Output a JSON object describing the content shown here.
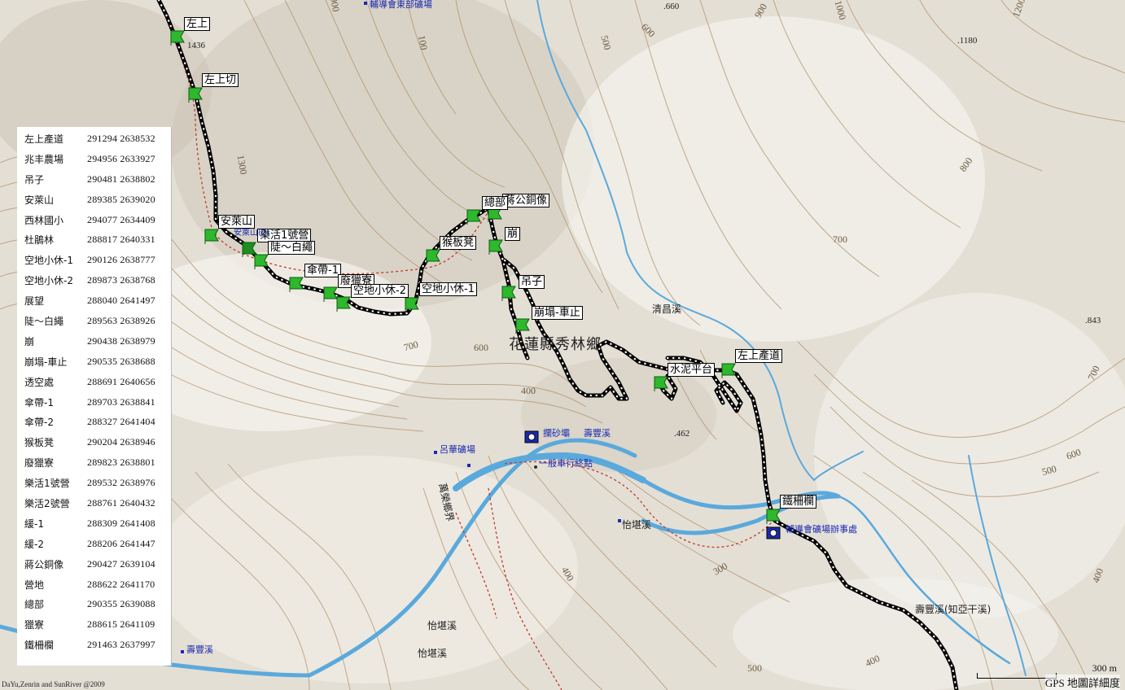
{
  "waypoint_table": [
    {
      "name": "左上產道",
      "e": "291294",
      "n": "2638532"
    },
    {
      "name": "兆丰農場",
      "e": "294956",
      "n": "2633927"
    },
    {
      "name": "吊子",
      "e": "290481",
      "n": "2638802"
    },
    {
      "name": "安萊山",
      "e": "289385",
      "n": "2639020"
    },
    {
      "name": "西林國小",
      "e": "294077",
      "n": "2634409"
    },
    {
      "name": "杜鵑林",
      "e": "288817",
      "n": "2640331"
    },
    {
      "name": "空地小休-1",
      "e": "290126",
      "n": "2638777"
    },
    {
      "name": "空地小休-2",
      "e": "289873",
      "n": "2638768"
    },
    {
      "name": "展望",
      "e": "288040",
      "n": "2641497"
    },
    {
      "name": "陡～白繩",
      "e": "289563",
      "n": "2638926"
    },
    {
      "name": "崩",
      "e": "290438",
      "n": "2638979"
    },
    {
      "name": "崩塌-車止",
      "e": "290535",
      "n": "2638688"
    },
    {
      "name": "透空處",
      "e": "288691",
      "n": "2640656"
    },
    {
      "name": "傘帶-1",
      "e": "289703",
      "n": "2638841"
    },
    {
      "name": "傘帶-2",
      "e": "288327",
      "n": "2641404"
    },
    {
      "name": "猴板凳",
      "e": "290204",
      "n": "2638946"
    },
    {
      "name": "廢獵寮",
      "e": "289823",
      "n": "2638801"
    },
    {
      "name": "樂活1號營",
      "e": "289532",
      "n": "2638976"
    },
    {
      "name": "樂活2號營",
      "e": "288761",
      "n": "2640432"
    },
    {
      "name": "緩-1",
      "e": "288309",
      "n": "2641408"
    },
    {
      "name": "緩-2",
      "e": "288206",
      "n": "2641447"
    },
    {
      "name": "蔣公銅像",
      "e": "290427",
      "n": "2639104"
    },
    {
      "name": "營地",
      "e": "288622",
      "n": "2641170"
    },
    {
      "name": "總部",
      "e": "290355",
      "n": "2639088"
    },
    {
      "name": "獵寮",
      "e": "288615",
      "n": "2641109"
    },
    {
      "name": "鐵柵欄",
      "e": "291463",
      "n": "2637997"
    }
  ],
  "map_labels": {
    "wp_zuoshang": "左上",
    "wp_zuoshang_qie": "左上切",
    "wp_anlai": "安萊山",
    "wp_lehuo": "樂活1號營",
    "wp_dou": "陡～白繩",
    "wp_sandai": "傘帶-1",
    "wp_feilie": "廢獵寮",
    "wp_kongdi2": "空地小休-2",
    "wp_kongdi1": "空地小休-1",
    "wp_houban": "猴板凳",
    "wp_jianggong": "蔣公銅像",
    "wp_zongbu": "總部",
    "wp_beng": "崩",
    "wp_diaozi": "吊子",
    "wp_bengta": "崩塌-車止",
    "wp_shuini": "水泥平台",
    "wp_zuoshang_road": "左上產道",
    "wp_tiezha": "鐵柵欄",
    "poi_fudao_top": "輔導會東部礦場",
    "poi_lanshaba": "攔砂壩",
    "poi_shoufeng1": "壽豐溪",
    "poi_lvhua": "呂華礦場",
    "poi_yiban": "一般車行終點",
    "poi_fudao_office": "輔導會礦場辦事處",
    "poi_shoufeng2": "壽豐溪",
    "place_qingchang": "清昌溪",
    "place_yikan1": "怡堪溪",
    "place_yikan2": "怡堪溪",
    "place_yikan3": "怡堪溪",
    "place_wanrong": "萬榮鄉界",
    "place_shoufeng_long": "壽豐溪(知亞干溪)",
    "region_xiulin": "花蓮縣秀林鄉",
    "peak_1436": "1436",
    "peak_660": ".660",
    "peak_1180": ".1180",
    "peak_843": ".843",
    "peak_462": ".462",
    "c_1300": "1300",
    "c_900a": "900",
    "c_100": "100",
    "c_500a": "500",
    "c_600a": "600",
    "c_900b": "900",
    "c_1000": "1000",
    "c_800": "800",
    "c_700a": "700",
    "c_700b": "700",
    "c_600b": "600",
    "c_400a": "400",
    "c_600c": "600",
    "c_500b": "500",
    "c_400b": "400",
    "c_300": "300",
    "c_500c": "500",
    "c_400c": "400",
    "c_400d": "400",
    "c_1200": "1200",
    "c_700c": "700",
    "anlai_small": "安萊山(2)"
  },
  "credit": "DaYu,Zenrin and SunRiver @2009",
  "scale": {
    "value": "300 m",
    "label": "GPS 地圖詳細度"
  },
  "colors": {
    "land": "#e9e4da",
    "contour": "#a7865a",
    "river": "#5aa9dc",
    "track": "#000000",
    "flag": "#2db82d",
    "trail": "#c0392b"
  }
}
